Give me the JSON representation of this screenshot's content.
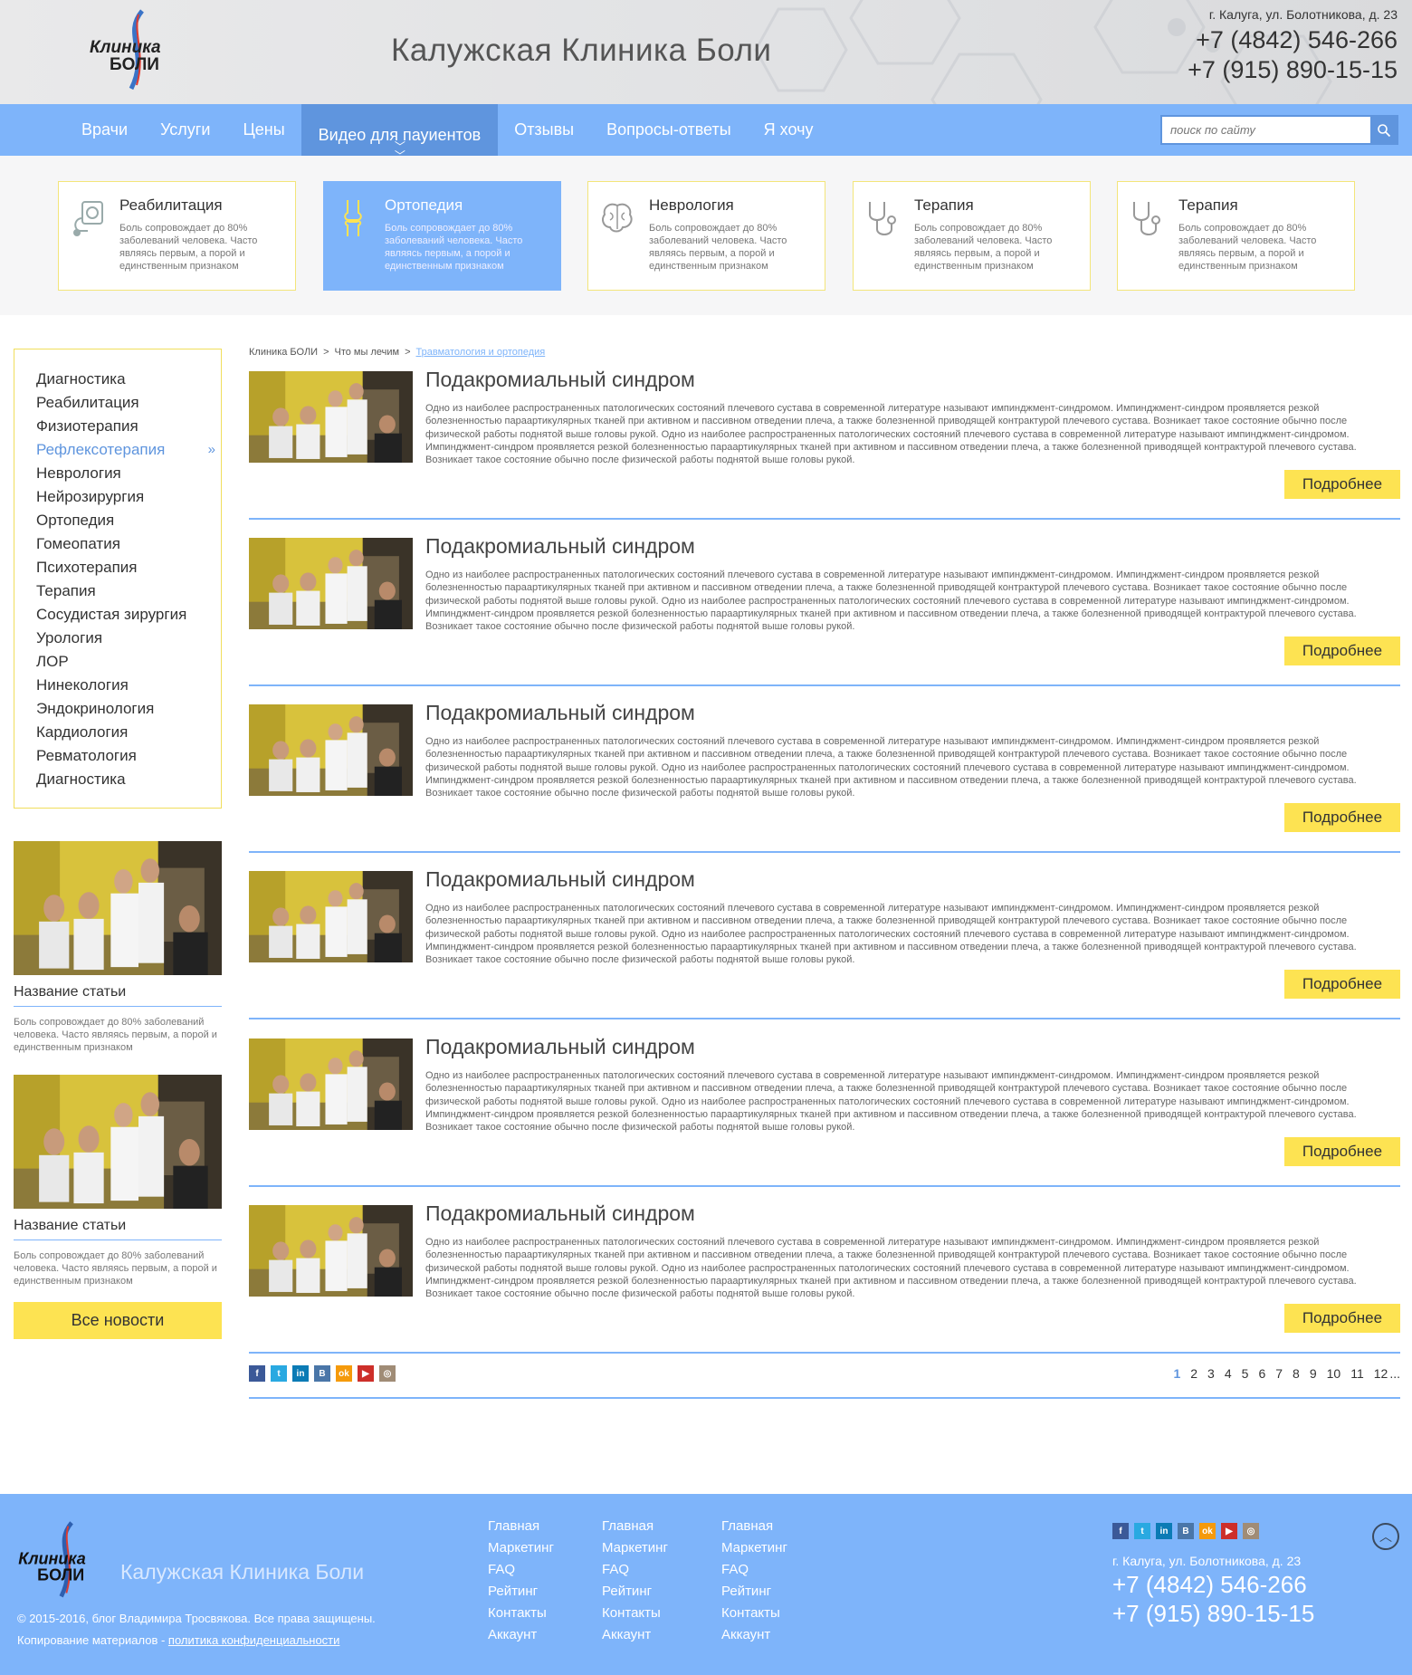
{
  "header": {
    "logo_text_1": "Клиника",
    "logo_text_2": "БОЛИ",
    "title": "Калужская Клиника Боли",
    "address": "г. Калуга, ул. Болотникова, д. 23",
    "phone1": "+7 (4842) 546-266",
    "phone2": "+7 (915) 890-15-15"
  },
  "nav": {
    "items": [
      {
        "label": "Врачи"
      },
      {
        "label": "Услуги"
      },
      {
        "label": "Цены"
      },
      {
        "label": "Видео для пауиентов",
        "active": true
      },
      {
        "label": "Отзывы"
      },
      {
        "label": "Вопросы-ответы"
      },
      {
        "label": "Я хочу"
      }
    ],
    "search_placeholder": "поиск по сайту"
  },
  "categories": [
    {
      "title": "Реабилитация",
      "icon": "tonometer-icon",
      "desc": "Боль сопровождает до 80% заболеваний человека. Часто являясь первым, а порой и единственным признаком"
    },
    {
      "title": "Ортопедия",
      "icon": "joint-icon",
      "active": true,
      "desc": "Боль сопровождает до 80% заболеваний человека. Часто являясь первым, а порой и единственным признаком"
    },
    {
      "title": "Неврология",
      "icon": "brain-icon",
      "desc": "Боль сопровождает до 80% заболеваний человека. Часто являясь первым, а порой и единственным признаком"
    },
    {
      "title": "Терапия",
      "icon": "stethoscope-icon",
      "desc": "Боль сопровождает до 80% заболеваний человека. Часто являясь первым, а порой и единственным признаком"
    },
    {
      "title": "Терапия",
      "icon": "stethoscope-icon",
      "desc": "Боль сопровождает до 80% заболеваний человека. Часто являясь первым, а порой и единственным признаком"
    }
  ],
  "sidebar": {
    "menu": [
      "Диагностика",
      "Реабилитация",
      "Физиотерапия",
      "Рефлексотерапия",
      "Неврология",
      "Нейрозирургия",
      "Ортопедия",
      "Гомеопатия",
      "Психотерапия",
      "Терапия",
      "Сосудистая зирургия",
      "Урология",
      "ЛОР",
      "Нинекология",
      "Эндокринология",
      "Кардиология",
      "Ревматология",
      "Диагностика"
    ],
    "active_index": 3,
    "news": [
      {
        "title": "Название статьи",
        "desc": "Боль сопровождает до 80% заболеваний человека. Часто являясь первым, а порой и единственным признаком"
      },
      {
        "title": "Название статьи",
        "desc": "Боль сопровождает до 80% заболеваний человека. Часто являясь первым, а порой и единственным признаком"
      }
    ],
    "all_news_label": "Все новости"
  },
  "breadcrumb": {
    "items": [
      "Клиника БОЛИ",
      "Что мы лечим",
      "Травматология и ортопедия"
    ],
    "separator": ">"
  },
  "articles": [
    {
      "title": "Подакромиальный синдром",
      "desc": "Одно из наиболее распространенных патологических состояний плечевого сустава в современной литературе называют импинджмент-синдромом. Импинджмент-синдром проявляется резкой болезненностью параартикулярных тканей при активном и пассивном  отведении плеча, а также болезненной приводящей контрактурой плечевого сустава. Возникает такое состояние обычно после физической работы поднятой выше головы рукой. Одно из наиболее распространенных патологических состояний плечевого сустава в современной литературе называют импинджмент-синдромом. Импинджмент-синдром проявляется резкой болезненностью параартикулярных тканей при активном и пассивном  отведении плеча, а также болезненной приводящей контрактурой плечевого сустава. Возникает такое состояние обычно после физической работы поднятой выше головы рукой.",
      "more": "Подробнее"
    },
    {
      "title": "Подакромиальный синдром",
      "desc": "Одно из наиболее распространенных патологических состояний плечевого сустава в современной литературе называют импинджмент-синдромом. Импинджмент-синдром проявляется резкой болезненностью параартикулярных тканей при активном и пассивном  отведении плеча, а также болезненной приводящей контрактурой плечевого сустава. Возникает такое состояние обычно после физической работы поднятой выше головы рукой. Одно из наиболее распространенных патологических состояний плечевого сустава в современной литературе называют импинджмент-синдромом. Импинджмент-синдром проявляется резкой болезненностью параартикулярных тканей при активном и пассивном  отведении плеча, а также болезненной приводящей контрактурой плечевого сустава. Возникает такое состояние обычно после физической работы поднятой выше головы рукой.",
      "more": "Подробнее"
    },
    {
      "title": "Подакромиальный синдром",
      "desc": "Одно из наиболее распространенных патологических состояний плечевого сустава в современной литературе называют импинджмент-синдромом. Импинджмент-синдром проявляется резкой болезненностью параартикулярных тканей при активном и пассивном  отведении плеча, а также болезненной приводящей контрактурой плечевого сустава. Возникает такое состояние обычно после физической работы поднятой выше головы рукой. Одно из наиболее распространенных патологических состояний плечевого сустава в современной литературе называют импинджмент-синдромом. Импинджмент-синдром проявляется резкой болезненностью параартикулярных тканей при активном и пассивном  отведении плеча, а также болезненной приводящей контрактурой плечевого сустава. Возникает такое состояние обычно после физической работы поднятой выше головы рукой.",
      "more": "Подробнее"
    },
    {
      "title": "Подакромиальный синдром",
      "desc": "Одно из наиболее распространенных патологических состояний плечевого сустава в современной литературе называют импинджмент-синдромом. Импинджмент-синдром проявляется резкой болезненностью параартикулярных тканей при активном и пассивном  отведении плеча, а также болезненной приводящей контрактурой плечевого сустава. Возникает такое состояние обычно после физической работы поднятой выше головы рукой. Одно из наиболее распространенных патологических состояний плечевого сустава в современной литературе называют импинджмент-синдромом. Импинджмент-синдром проявляется резкой болезненностью параартикулярных тканей при активном и пассивном  отведении плеча, а также болезненной приводящей контрактурой плечевого сустава. Возникает такое состояние обычно после физической работы поднятой выше головы рукой.",
      "more": "Подробнее"
    },
    {
      "title": "Подакромиальный синдром",
      "desc": "Одно из наиболее распространенных патологических состояний плечевого сустава в современной литературе называют импинджмент-синдромом. Импинджмент-синдром проявляется резкой болезненностью параартикулярных тканей при активном и пассивном  отведении плеча, а также болезненной приводящей контрактурой плечевого сустава. Возникает такое состояние обычно после физической работы поднятой выше головы рукой. Одно из наиболее распространенных патологических состояний плечевого сустава в современной литературе называют импинджмент-синдромом. Импинджмент-синдром проявляется резкой болезненностью параартикулярных тканей при активном и пассивном  отведении плеча, а также болезненной приводящей контрактурой плечевого сустава. Возникает такое состояние обычно после физической работы поднятой выше головы рукой.",
      "more": "Подробнее"
    },
    {
      "title": "Подакромиальный синдром",
      "desc": "Одно из наиболее распространенных патологических состояний плечевого сустава в современной литературе называют импинджмент-синдромом. Импинджмент-синдром проявляется резкой болезненностью параартикулярных тканей при активном и пассивном  отведении плеча, а также болезненной приводящей контрактурой плечевого сустава. Возникает такое состояние обычно после физической работы поднятой выше головы рукой. Одно из наиболее распространенных патологических состояний плечевого сустава в современной литературе называют импинджмент-синдромом. Импинджмент-синдром проявляется резкой болезненностью параартикулярных тканей при активном и пассивном  отведении плеча, а также болезненной приводящей контрактурой плечевого сустава. Возникает такое состояние обычно после физической работы поднятой выше головы рукой.",
      "more": "Подробнее"
    }
  ],
  "social": [
    {
      "name": "facebook-icon",
      "glyph": "f",
      "color": "#3b5998"
    },
    {
      "name": "twitter-icon",
      "glyph": "t",
      "color": "#29a9e1"
    },
    {
      "name": "linkedin-icon",
      "glyph": "in",
      "color": "#0b7bb5"
    },
    {
      "name": "vk-icon",
      "glyph": "B",
      "color": "#4a76a8"
    },
    {
      "name": "odnoklassniki-icon",
      "glyph": "ok",
      "color": "#f59a0b"
    },
    {
      "name": "youtube-icon",
      "glyph": "▶",
      "color": "#cd2f2a"
    },
    {
      "name": "instagram-icon",
      "glyph": "◎",
      "color": "#a08c76"
    }
  ],
  "pagination": {
    "pages": [
      "1",
      "2",
      "3",
      "4",
      "5",
      "6",
      "7",
      "8",
      "9",
      "10",
      "11",
      "12"
    ],
    "current": "1",
    "ellipsis": "..."
  },
  "footer": {
    "title": "Калужская Клиника Боли",
    "copyright": "© 2015-2016, блог Владимира Тросвякова. Все права защищены.",
    "copy_note": "Копирование материалов -",
    "policy_link": "политика конфиденциальности",
    "columns": [
      [
        "Главная",
        "Маркетинг",
        "FAQ",
        "Рейтинг",
        "Контакты",
        "Аккаунт"
      ],
      [
        "Главная",
        "Маркетинг",
        "FAQ",
        "Рейтинг",
        "Контакты",
        "Аккаунт"
      ],
      [
        "Главная",
        "Маркетинг",
        "FAQ",
        "Рейтинг",
        "Контакты",
        "Аккаунт"
      ]
    ],
    "address": "г. Калуга, ул. Болотникова, д. 23",
    "phone1": "+7 (4842) 546-266",
    "phone2": "+7 (915) 890-15-15"
  },
  "colors": {
    "accent_blue": "#7eb4fa",
    "active_blue": "#5f95de",
    "yellow": "#fde352"
  }
}
